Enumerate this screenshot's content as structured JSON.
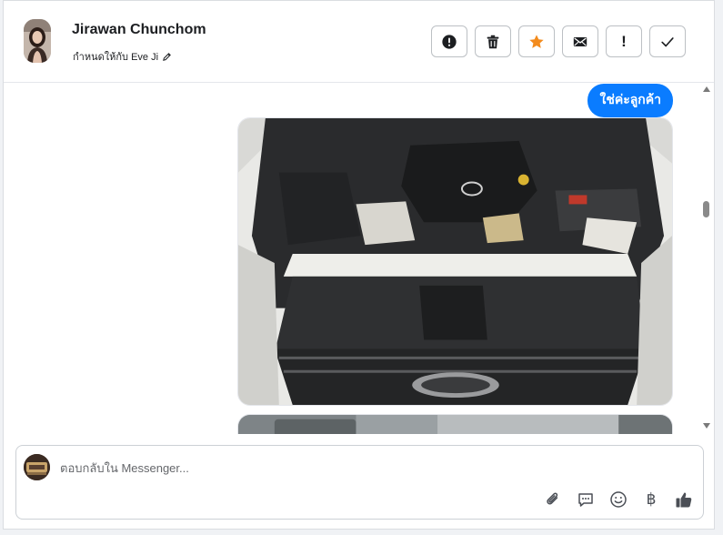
{
  "header": {
    "contact_name": "Jirawan Chunchom",
    "assigned_text": "กำหนดให้กับ Eve Ji",
    "actions": [
      {
        "name": "report-spam-button",
        "icon": "exclamation-circle-icon"
      },
      {
        "name": "delete-button",
        "icon": "trash-icon"
      },
      {
        "name": "star-button",
        "icon": "star-icon",
        "color": "#f38b1d"
      },
      {
        "name": "mark-unread-button",
        "icon": "envelope-icon"
      },
      {
        "name": "follow-up-button",
        "icon": "exclamation-icon",
        "label": "!"
      },
      {
        "name": "mark-done-button",
        "icon": "checkmark-icon"
      }
    ]
  },
  "messages": {
    "bubble_text": "ใช่ค่ะลูกค้า",
    "bubble_color": "#0a7cff",
    "images": [
      "truck-engine-bay-photo",
      "truck-photo-partial"
    ]
  },
  "composer": {
    "placeholder": "ตอบกลับใน Messenger...",
    "tools": [
      "paperclip-icon",
      "saved-reply-icon",
      "emoji-icon",
      "baht-icon",
      "thumbs-up-icon"
    ],
    "baht_symbol": "฿"
  }
}
